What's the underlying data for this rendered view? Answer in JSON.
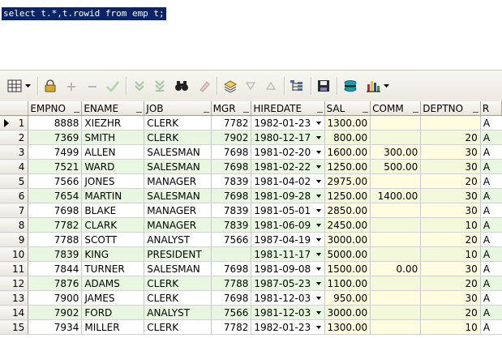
{
  "editor": {
    "sql": "select t.*,t.rowid from emp t;"
  },
  "toolbar": {
    "items": [
      {
        "name": "grid-view-icon",
        "glyph": "▦"
      },
      {
        "name": "dropdown-arrow-icon",
        "glyph": "▾"
      },
      {
        "name": "lock-icon",
        "glyph": "🔒"
      },
      {
        "name": "add-record-icon",
        "glyph": "+"
      },
      {
        "name": "delete-record-icon",
        "glyph": "−"
      },
      {
        "name": "post-changes-icon",
        "glyph": "✔"
      },
      {
        "name": "fetch-next-icon",
        "glyph": "⇊"
      },
      {
        "name": "fetch-last-icon",
        "glyph": "⇓"
      },
      {
        "name": "find-binoculars-icon",
        "glyph": "⛶"
      },
      {
        "name": "clear-eraser-icon",
        "glyph": "✎"
      },
      {
        "name": "query-by-example-icon",
        "glyph": "◈"
      },
      {
        "name": "filter-down-icon",
        "glyph": "▽"
      },
      {
        "name": "filter-up-icon",
        "glyph": "△"
      },
      {
        "name": "tree-view-icon",
        "glyph": "⋲"
      },
      {
        "name": "save-icon",
        "glyph": "▣"
      },
      {
        "name": "export-icon",
        "glyph": "⛁"
      },
      {
        "name": "chart-icon",
        "glyph": "▥"
      },
      {
        "name": "chart-dropdown-icon",
        "glyph": "▾"
      }
    ]
  },
  "grid": {
    "columns": [
      "EMPNO",
      "ENAME",
      "JOB",
      "MGR",
      "HIREDATE",
      "SAL",
      "COMM",
      "DEPTNO",
      "R"
    ],
    "rows": [
      {
        "n": "1",
        "empno": "8888",
        "ename": "XIEZHR",
        "job": "CLERK",
        "mgr": "7782",
        "hiredate": "1982-01-23",
        "sal": "1300.00",
        "comm": "",
        "deptno": "",
        "r": "A"
      },
      {
        "n": "2",
        "empno": "7369",
        "ename": "SMITH",
        "job": "CLERK",
        "mgr": "7902",
        "hiredate": "1980-12-17",
        "sal": "800.00",
        "comm": "",
        "deptno": "20",
        "r": "A"
      },
      {
        "n": "3",
        "empno": "7499",
        "ename": "ALLEN",
        "job": "SALESMAN",
        "mgr": "7698",
        "hiredate": "1981-02-20",
        "sal": "1600.00",
        "comm": "300.00",
        "deptno": "30",
        "r": "A"
      },
      {
        "n": "4",
        "empno": "7521",
        "ename": "WARD",
        "job": "SALESMAN",
        "mgr": "7698",
        "hiredate": "1981-02-22",
        "sal": "1250.00",
        "comm": "500.00",
        "deptno": "30",
        "r": "A"
      },
      {
        "n": "5",
        "empno": "7566",
        "ename": "JONES",
        "job": "MANAGER",
        "mgr": "7839",
        "hiredate": "1981-04-02",
        "sal": "2975.00",
        "comm": "",
        "deptno": "20",
        "r": "A"
      },
      {
        "n": "6",
        "empno": "7654",
        "ename": "MARTIN",
        "job": "SALESMAN",
        "mgr": "7698",
        "hiredate": "1981-09-28",
        "sal": "1250.00",
        "comm": "1400.00",
        "deptno": "30",
        "r": "A"
      },
      {
        "n": "7",
        "empno": "7698",
        "ename": "BLAKE",
        "job": "MANAGER",
        "mgr": "7839",
        "hiredate": "1981-05-01",
        "sal": "2850.00",
        "comm": "",
        "deptno": "30",
        "r": "A"
      },
      {
        "n": "8",
        "empno": "7782",
        "ename": "CLARK",
        "job": "MANAGER",
        "mgr": "7839",
        "hiredate": "1981-06-09",
        "sal": "2450.00",
        "comm": "",
        "deptno": "10",
        "r": "A"
      },
      {
        "n": "9",
        "empno": "7788",
        "ename": "SCOTT",
        "job": "ANALYST",
        "mgr": "7566",
        "hiredate": "1987-04-19",
        "sal": "3000.00",
        "comm": "",
        "deptno": "20",
        "r": "A"
      },
      {
        "n": "10",
        "empno": "7839",
        "ename": "KING",
        "job": "PRESIDENT",
        "mgr": "",
        "hiredate": "1981-11-17",
        "sal": "5000.00",
        "comm": "",
        "deptno": "10",
        "r": "A"
      },
      {
        "n": "11",
        "empno": "7844",
        "ename": "TURNER",
        "job": "SALESMAN",
        "mgr": "7698",
        "hiredate": "1981-09-08",
        "sal": "1500.00",
        "comm": "0.00",
        "deptno": "30",
        "r": "A"
      },
      {
        "n": "12",
        "empno": "7876",
        "ename": "ADAMS",
        "job": "CLERK",
        "mgr": "7788",
        "hiredate": "1987-05-23",
        "sal": "1100.00",
        "comm": "",
        "deptno": "20",
        "r": "A"
      },
      {
        "n": "13",
        "empno": "7900",
        "ename": "JAMES",
        "job": "CLERK",
        "mgr": "7698",
        "hiredate": "1981-12-03",
        "sal": "950.00",
        "comm": "",
        "deptno": "30",
        "r": "A"
      },
      {
        "n": "14",
        "empno": "7902",
        "ename": "FORD",
        "job": "ANALYST",
        "mgr": "7566",
        "hiredate": "1981-12-03",
        "sal": "3000.00",
        "comm": "",
        "deptno": "20",
        "r": "A"
      },
      {
        "n": "15",
        "empno": "7934",
        "ename": "MILLER",
        "job": "CLERK",
        "mgr": "7782",
        "hiredate": "1982-01-23",
        "sal": "1300.00",
        "comm": "",
        "deptno": "10",
        "r": "A"
      }
    ]
  }
}
